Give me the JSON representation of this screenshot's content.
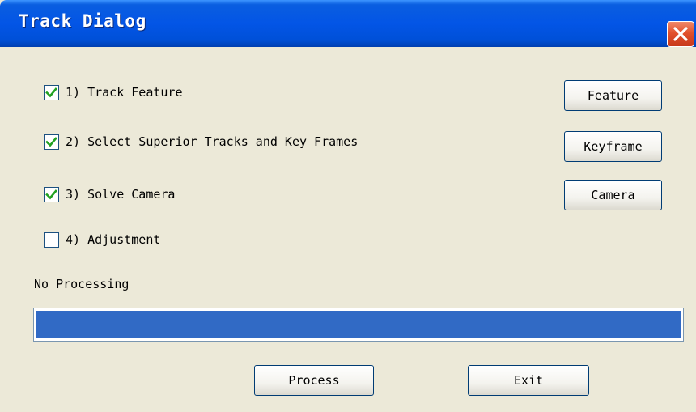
{
  "window": {
    "title": "Track Dialog",
    "close_icon": "close-icon"
  },
  "steps": [
    {
      "label": "1) Track Feature",
      "checked": true
    },
    {
      "label": "2) Select Superior Tracks and Key Frames",
      "checked": true
    },
    {
      "label": "3) Solve Camera",
      "checked": true
    },
    {
      "label": "4) Adjustment",
      "checked": false
    }
  ],
  "side_buttons": {
    "feature": "Feature",
    "keyframe": "Keyframe",
    "camera": "Camera"
  },
  "status": {
    "text": "No Processing",
    "progress_percent": 100,
    "progress_color": "#316ac5"
  },
  "footer": {
    "process": "Process",
    "exit": "Exit"
  },
  "colors": {
    "titlebar": "#0355e6",
    "window_bg": "#ece9d8",
    "close_button": "#e2512c"
  }
}
